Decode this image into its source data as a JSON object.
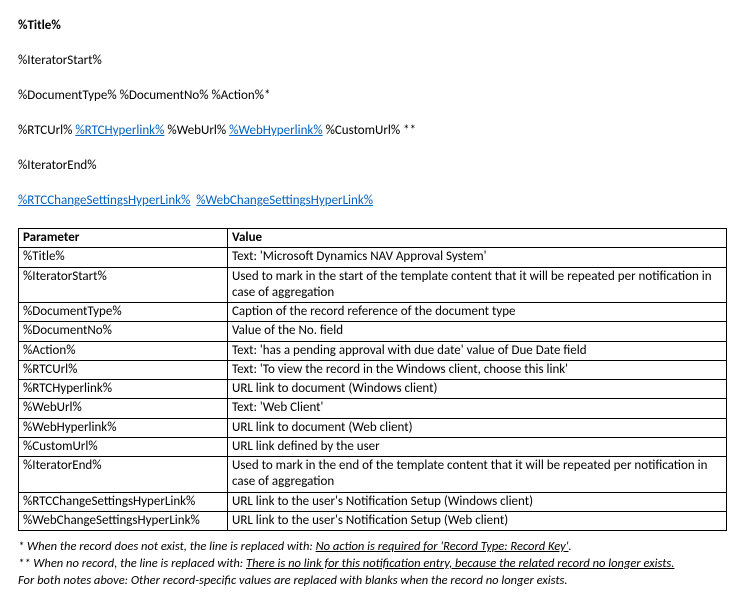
{
  "template": {
    "title": "%Title%",
    "iteratorStart": "%IteratorStart%",
    "docLine": {
      "docType": "%DocumentType%",
      "docNo": "%DocumentNo%",
      "action": "%Action%",
      "star1": "*"
    },
    "urlLine": {
      "rtcUrl": "%RTCUrl%",
      "rtcHyperlink": "%RTCHyperlink%",
      "webUrl": "%WebUrl%",
      "webHyperlink": "%WebHyperlink%",
      "customUrl": "%CustomUrl%",
      "star2": "**"
    },
    "iteratorEnd": "%IteratorEnd%",
    "settingsLine": {
      "rtcChange": "%RTCChangeSettingsHyperLink%",
      "webChange": "%WebChangeSettingsHyperLink%"
    }
  },
  "tableHeaders": {
    "param": "Parameter",
    "value": "Value"
  },
  "rows": [
    {
      "param": "%Title%",
      "value": "Text: 'Microsoft Dynamics NAV Approval System'"
    },
    {
      "param": "%IteratorStart%",
      "value": "Used to mark in the start of the template content that it will be repeated per notification in case of aggregation"
    },
    {
      "param": "%DocumentType%",
      "value": "Caption of the record reference of the document type"
    },
    {
      "param": "%DocumentNo%",
      "value": "Value of the No. field"
    },
    {
      "param": "%Action%",
      "value": "Text: 'has a pending approval with due date' value of Due Date field"
    },
    {
      "param": "%RTCUrl%",
      "value": "Text: 'To view the record in the Windows client, choose this link'"
    },
    {
      "param": "%RTCHyperlink%",
      "value": "URL link to document (Windows client)"
    },
    {
      "param": "%WebUrl%",
      "value": "Text: 'Web Client'"
    },
    {
      "param": "%WebHyperlink%",
      "value": "URL link to document (Web client)"
    },
    {
      "param": "%CustomUrl%",
      "value": "URL link defined by the user"
    },
    {
      "param": "%IteratorEnd%",
      "value": "Used to mark in the end of the template content that it will be repeated per notification in case of aggregation"
    },
    {
      "param": "%RTCChangeSettingsHyperLink%",
      "value": "URL link to the user's Notification Setup (Windows client)"
    },
    {
      "param": "%WebChangeSettingsHyperLink%",
      "value": "URL link to the user's Notification Setup (Web client)"
    }
  ],
  "footnotes": {
    "n1_pre": "* When the record does not exist, the line is replaced with: ",
    "n1_u": "No action is required for 'Record Type: Record Key'",
    "n1_post": ".",
    "n2_pre": "** When no record, the line is replaced with: ",
    "n2_u": "There is no link for this notification entry, because the related record no longer exists.",
    "n3": "For both notes above: Other record-specific values are replaced with blanks when the record no longer exists."
  }
}
